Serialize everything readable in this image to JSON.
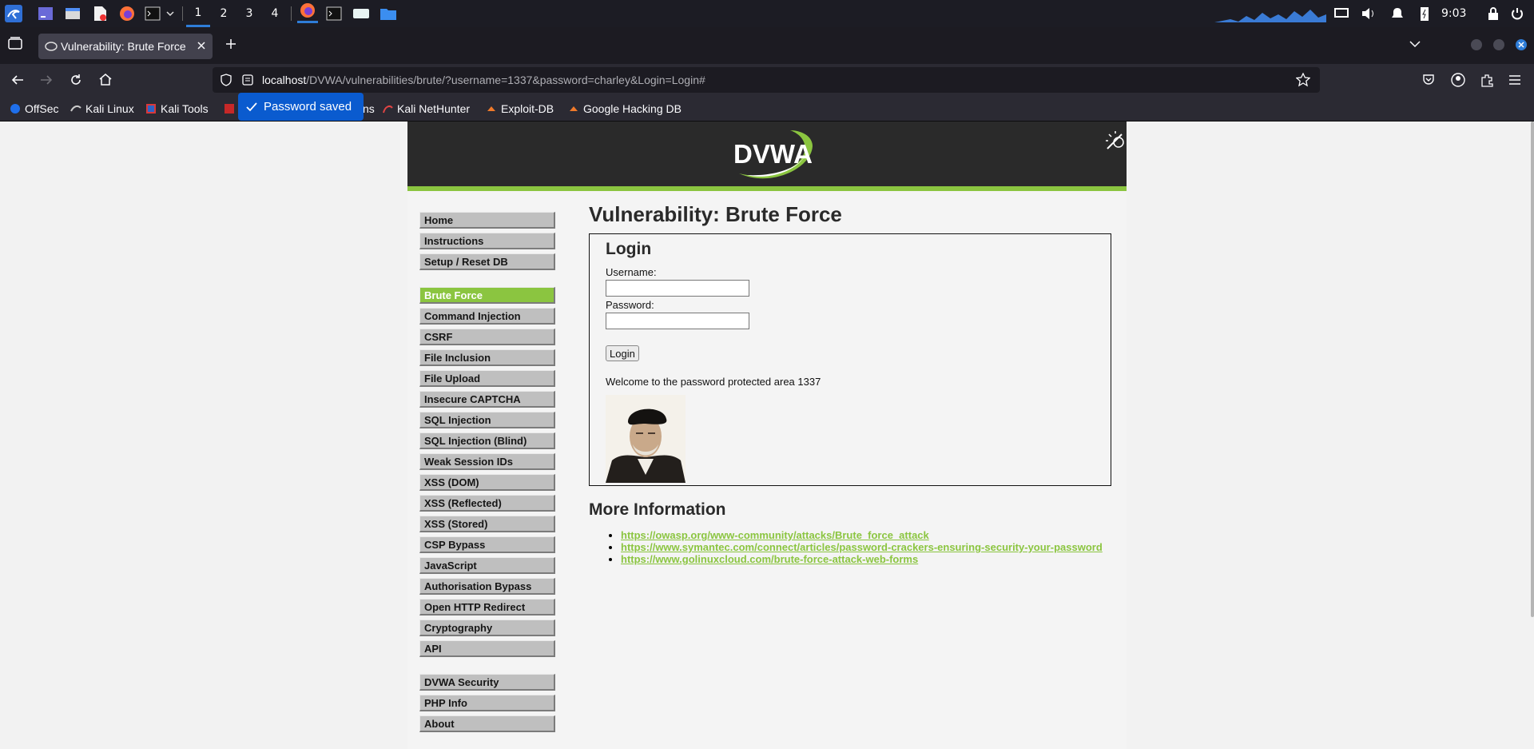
{
  "taskbar": {
    "workspaces": [
      "1",
      "2",
      "3",
      "4"
    ],
    "clock": "9:03"
  },
  "browser": {
    "tab_title": "Vulnerability: Brute Force",
    "url_host": "localhost",
    "url_path": "/DVWA/vulnerabilities/brute/?username=1337&password=charley&Login=Login#",
    "bookmarks": [
      "OffSec",
      "Kali Linux",
      "Kali Tools",
      "ns",
      "Kali NetHunter",
      "Exploit-DB",
      "Google Hacking DB"
    ],
    "notification": "Password saved"
  },
  "dvwa": {
    "logo_text": "DVWA",
    "menu": {
      "group1": [
        "Home",
        "Instructions",
        "Setup / Reset DB"
      ],
      "group2": [
        "Brute Force",
        "Command Injection",
        "CSRF",
        "File Inclusion",
        "File Upload",
        "Insecure CAPTCHA",
        "SQL Injection",
        "SQL Injection (Blind)",
        "Weak Session IDs",
        "XSS (DOM)",
        "XSS (Reflected)",
        "XSS (Stored)",
        "CSP Bypass",
        "JavaScript",
        "Authorisation Bypass",
        "Open HTTP Redirect",
        "Cryptography",
        "API"
      ],
      "group3": [
        "DVWA Security",
        "PHP Info",
        "About"
      ],
      "selected": "Brute Force"
    },
    "page_title": "Vulnerability: Brute Force",
    "login": {
      "heading": "Login",
      "username_label": "Username:",
      "username_value": "",
      "password_label": "Password:",
      "password_value": "",
      "button": "Login",
      "welcome": "Welcome to the password protected area 1337"
    },
    "more_info": {
      "heading": "More Information",
      "links": [
        "https://owasp.org/www-community/attacks/Brute_force_attack",
        "https://www.symantec.com/connect/articles/password-crackers-ensuring-security-your-password",
        "https://www.golinuxcloud.com/brute-force-attack-web-forms"
      ]
    }
  },
  "colors": {
    "dvwa_green": "#8bc540",
    "header_dark": "#2a2a2a",
    "firefox_toolbar": "#2b2a33",
    "notification_blue": "#0a5bcf"
  }
}
